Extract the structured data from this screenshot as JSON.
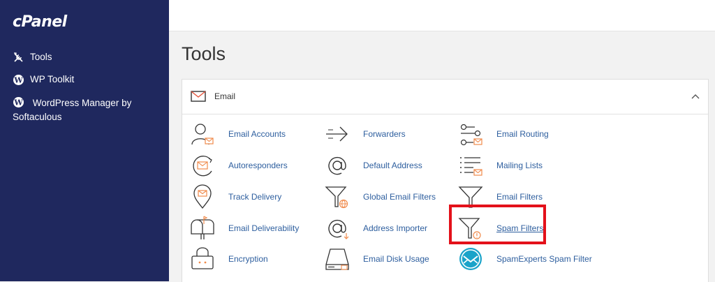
{
  "brand": {
    "logo_text": "cPanel"
  },
  "sidebar": {
    "items": [
      {
        "label": "Tools",
        "icon": "tools-icon"
      },
      {
        "label": "WP Toolkit",
        "icon": "wordpress-icon"
      },
      {
        "label": "WordPress Manager by Softaculous",
        "icon": "wordpress-icon"
      }
    ]
  },
  "page": {
    "title": "Tools"
  },
  "section": {
    "name": "Email",
    "icon": "envelope-icon",
    "expanded": true
  },
  "tools": {
    "email_accounts": "Email Accounts",
    "forwarders": "Forwarders",
    "email_routing": "Email Routing",
    "autoresponders": "Autoresponders",
    "default_address": "Default Address",
    "mailing_lists": "Mailing Lists",
    "track_delivery": "Track Delivery",
    "global_email_filters": "Global Email Filters",
    "email_filters": "Email Filters",
    "email_deliverability": "Email Deliverability",
    "address_importer": "Address Importer",
    "spam_filters": "Spam Filters",
    "encryption": "Encryption",
    "email_disk_usage": "Email Disk Usage",
    "spamexperts_spam_filter": "SpamExperts Spam Filter"
  },
  "colors": {
    "sidebar_bg": "#1f285e",
    "icon_stroke": "#333333",
    "icon_accent": "#f08a4b",
    "link": "#2d5e9e",
    "highlight": "#e3111a",
    "spamexperts_teal": "#1aa3c9"
  }
}
